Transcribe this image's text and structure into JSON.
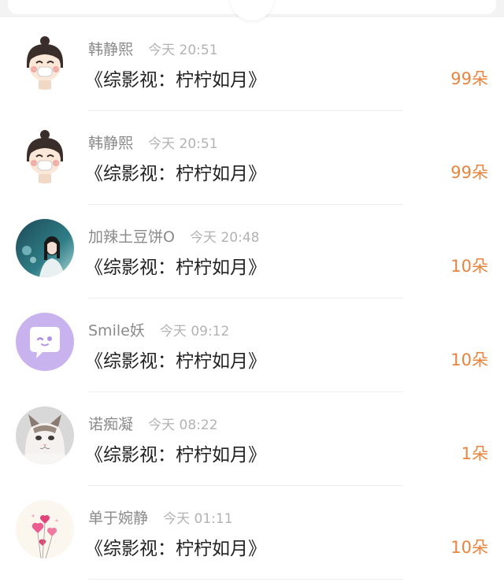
{
  "colors": {
    "accent": "#e8843d",
    "name": "#8a8a8a",
    "time": "#b3b3b3",
    "title": "#222222"
  },
  "items": [
    {
      "avatar_icon": "cartoon-girl-avatar-icon",
      "name": "韩静熙",
      "time": "今天 20:51",
      "title": "《综影视：柠柠如月》",
      "flowers": "99朵"
    },
    {
      "avatar_icon": "cartoon-girl-avatar-icon",
      "name": "韩静熙",
      "time": "今天 20:51",
      "title": "《综影视：柠柠如月》",
      "flowers": "99朵"
    },
    {
      "avatar_icon": "photo-girl-avatar-icon",
      "name": "加辣土豆饼O",
      "time": "今天 20:48",
      "title": "《综影视：柠柠如月》",
      "flowers": "10朵"
    },
    {
      "avatar_icon": "chat-bubble-avatar-icon",
      "name": "Smile妖",
      "time": "今天 09:12",
      "title": "《综影视：柠柠如月》",
      "flowers": "10朵"
    },
    {
      "avatar_icon": "cat-avatar-icon",
      "name": "诺痴凝",
      "time": "今天 08:22",
      "title": "《综影视：柠柠如月》",
      "flowers": "1朵"
    },
    {
      "avatar_icon": "hearts-avatar-icon",
      "name": "单于婉静",
      "time": "今天 01:11",
      "title": "《综影视：柠柠如月》",
      "flowers": "10朵"
    }
  ]
}
